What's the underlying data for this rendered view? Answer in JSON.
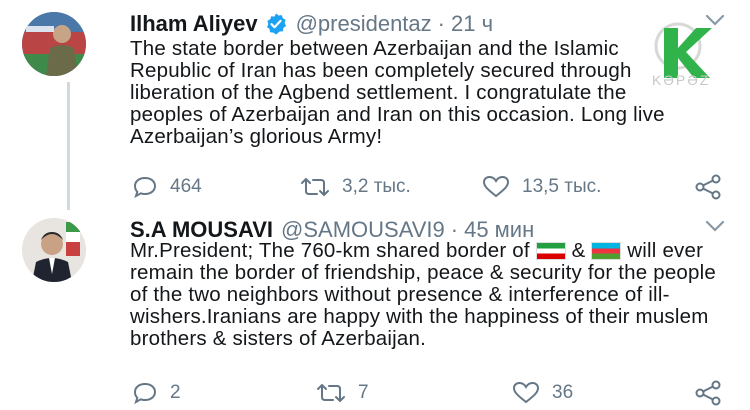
{
  "tweets": [
    {
      "name": "Ilham Aliyev",
      "handle": "@presidentaz",
      "dot": "·",
      "time": "21 ч",
      "text": "The state border between Azerbaijan and the Islamic Republic of Iran has been completely secured through liberation of the Agbend settlement. I congratulate the peoples of Azerbaijan and Iran on this occasion. Long live Azerbaijan’s glorious Army!",
      "replies": "464",
      "retweets": "3,2 тыс.",
      "likes": "13,5 тыс."
    },
    {
      "name": "S.A MOUSAVI",
      "handle": "@SAMOUSAVI9",
      "dot": "·",
      "time": "45 мин",
      "text_part1": "Mr.President; The 760-km shared border of",
      "text_part2": "&",
      "text_part3": "will ever remain the border of friendship, peace & security for the people of the two neighbors without presence & interference of ill-wishers.Iranians are happy with the happiness of their muslem brothers & sisters of Azerbaijan.",
      "replies": "2",
      "retweets": "7",
      "likes": "36"
    }
  ],
  "watermark": {
    "text": "KƏPƏZ"
  },
  "colors": {
    "verified": "#1da1f2",
    "secondary": "#657786",
    "logo_green": "#2fb34a"
  }
}
